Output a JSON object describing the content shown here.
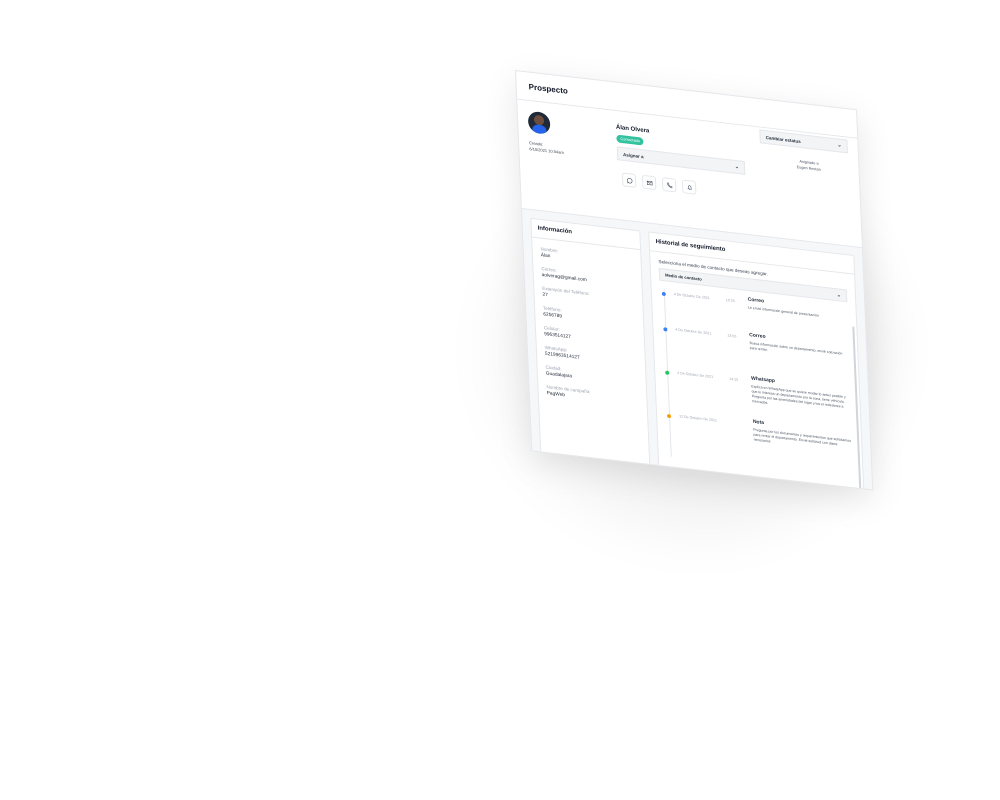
{
  "page": {
    "title": "Prospecto"
  },
  "profile": {
    "status_dropdown": "Cambiar estatus",
    "created_label": "Creado:",
    "created_value": "6/10/2021 10:04am",
    "name": "Álan Olvera",
    "status_badge": "Contactado",
    "assign_dropdown": "Asignar a",
    "assigned_label": "Asignado a",
    "assigned_value": "Eugen Rectan",
    "contact_actions": [
      {
        "icon": "whatsapp-icon"
      },
      {
        "icon": "mail-icon"
      },
      {
        "icon": "phone-icon"
      },
      {
        "icon": "bell-icon"
      }
    ]
  },
  "info": {
    "title": "Información",
    "fields": [
      {
        "label": "Nombre:",
        "value": "Álan"
      },
      {
        "label": "Correo:",
        "value": "aolverag@gmail.com"
      },
      {
        "label": "Extensión del Teléfono:",
        "value": "27"
      },
      {
        "label": "Teléfono:",
        "value": "6256789"
      },
      {
        "label": "Celular:",
        "value": "9963514127"
      },
      {
        "label": "WhatsApp:",
        "value": "5219963514127"
      },
      {
        "label": "Ciudad:",
        "value": "Guadalajara"
      },
      {
        "label": "Nombre de campaña:",
        "value": "PagWeb"
      }
    ]
  },
  "history": {
    "title": "Historial de seguimiento",
    "hint": "Selecciona el medio de contacto que deseas agregar.",
    "medium_dropdown": "Medio de contacto",
    "events": [
      {
        "date": "4 De Octubre De 2021",
        "time": "10:20",
        "type": "Correo",
        "description": "Le envié información general de presentación",
        "color": "#3b82f6"
      },
      {
        "date": "4 De Octubre De 2021",
        "time": "13:50",
        "type": "Correo",
        "description": "Busca información sobre un departamento, envié cotización para rentar.",
        "color": "#3b82f6"
      },
      {
        "date": "4 De Octubre De 2021",
        "time": "14:15",
        "type": "Whatsapp",
        "description": "Explica en WhatsApp que se quiere mudar lo antes posible y que le interesa un departamento por la zona, tiene vehículo. Pregunta por las amenidades del lugar y los el rededores a mercados.",
        "color": "#22c55e"
      },
      {
        "date": "12 De Octubre De 2021",
        "time": "",
        "type": "Nota",
        "description": "Pregunta por los documentos y requerimientos que solicitamos para rentar el departamento. Envié solicitud con datos necesarios",
        "color": "#f59e0b"
      }
    ]
  },
  "colors": {
    "accent_badge": "#34c29e",
    "dot_blue": "#3b82f6",
    "dot_green": "#22c55e",
    "dot_orange": "#f59e0b"
  }
}
